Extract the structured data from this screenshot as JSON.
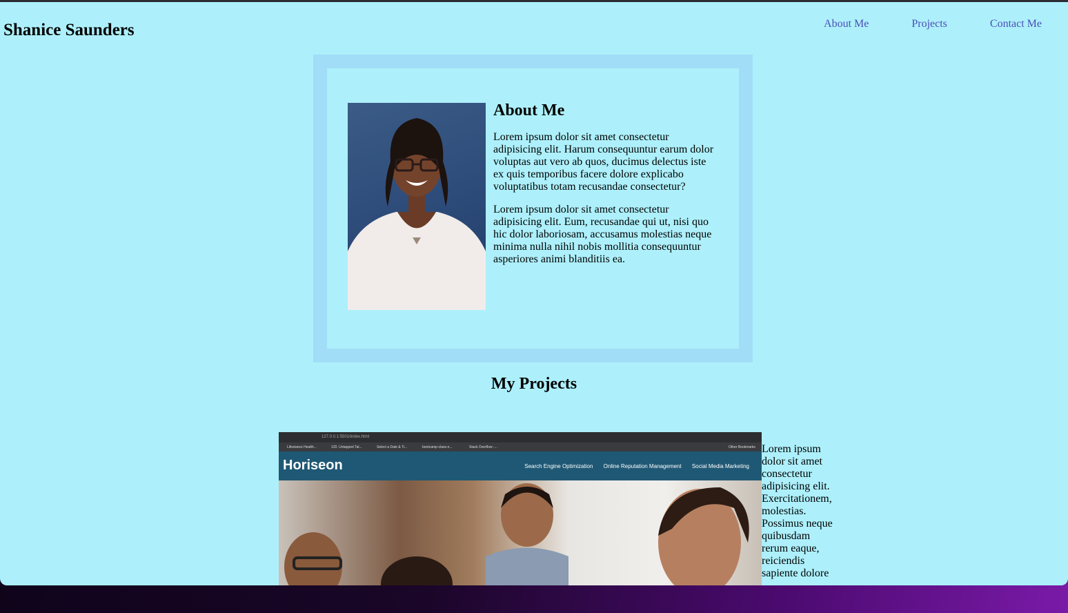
{
  "site": {
    "title": "Shanice Saunders",
    "nav": [
      "About Me",
      "Projects",
      "Contact Me"
    ]
  },
  "about": {
    "heading": "About Me",
    "paragraphs": [
      "Lorem ipsum dolor sit amet consectetur adipisicing elit. Harum consequuntur earum dolor voluptas aut vero ab quos, ducimus delectus iste ex quis temporibus facere dolore explicabo voluptatibus totam recusandae consectetur?",
      "Lorem ipsum dolor sit amet consectetur adipisicing elit. Eum, recusandae qui ut, nisi quo hic dolor laboriosam, accusamus molestias neque minima nulla nihil nobis mollitia consequuntur asperiores animi blanditiis ea."
    ]
  },
  "projects": {
    "heading": "My Projects",
    "screenshot": {
      "url": "127.0.0.1:5501/index.html",
      "bookmarks": [
        "Lifestance Health...",
        "120. Untapped Tal...",
        "Select a Date & Ti...",
        "bootcamp-class-n...",
        "Stack Overflow -...",
        "Other Bookmarks"
      ],
      "logo": "Horiseon",
      "nav": [
        "Search Engine Optimization",
        "Online Reputation Management",
        "Social Media Marketing"
      ]
    },
    "description": "Lorem ipsum dolor sit amet consectetur adipisicing elit. Exercitationem, molestias. Possimus neque quibusdam rerum eaque, reiciendis sapiente dolore"
  },
  "colors": {
    "page_background": "#adf0fb",
    "about_border": "#a2ddf7",
    "nav_link": "#4a4fb6",
    "horiseon_header": "#1f5874"
  }
}
